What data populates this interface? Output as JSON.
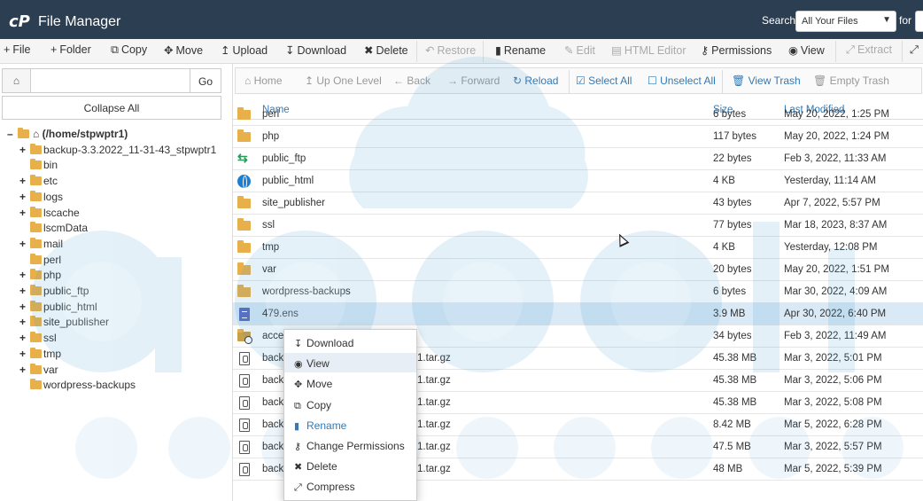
{
  "app": {
    "logo": "cP",
    "title": "File Manager"
  },
  "search": {
    "label": "Search",
    "scope": "All Your Files",
    "for_label": "for"
  },
  "toolbar": {
    "file": "File",
    "folder": "Folder",
    "copy": "Copy",
    "move": "Move",
    "upload": "Upload",
    "download": "Download",
    "delete": "Delete",
    "restore": "Restore",
    "rename": "Rename",
    "edit": "Edit",
    "html_editor": "HTML Editor",
    "permissions": "Permissions",
    "view": "View",
    "extract": "Extract"
  },
  "left": {
    "go": "Go",
    "collapse_all": "Collapse All",
    "path_value": ""
  },
  "tree": {
    "root": "(/home/stpwptr1)",
    "items": [
      {
        "label": "backup-3.3.2022_11-31-43_stpwptr1",
        "expandable": true
      },
      {
        "label": "bin",
        "expandable": false
      },
      {
        "label": "etc",
        "expandable": true
      },
      {
        "label": "logs",
        "expandable": true
      },
      {
        "label": "lscache",
        "expandable": true
      },
      {
        "label": "lscmData",
        "expandable": false
      },
      {
        "label": "mail",
        "expandable": true
      },
      {
        "label": "perl",
        "expandable": false
      },
      {
        "label": "php",
        "expandable": true
      },
      {
        "label": "public_ftp",
        "expandable": true
      },
      {
        "label": "public_html",
        "expandable": true
      },
      {
        "label": "site_publisher",
        "expandable": true
      },
      {
        "label": "ssl",
        "expandable": true
      },
      {
        "label": "tmp",
        "expandable": true
      },
      {
        "label": "var",
        "expandable": true
      },
      {
        "label": "wordpress-backups",
        "expandable": false
      }
    ]
  },
  "nav": {
    "home": "Home",
    "up": "Up One Level",
    "back": "Back",
    "forward": "Forward",
    "reload": "Reload",
    "select_all": "Select All",
    "unselect_all": "Unselect All",
    "view_trash": "View Trash",
    "empty_trash": "Empty Trash"
  },
  "columns": {
    "name": "Name",
    "size": "Size",
    "modified": "Last Modified"
  },
  "files": [
    {
      "name": "perl",
      "size": "6 bytes",
      "modified": "May 20, 2022, 1:25 PM",
      "icon": "folder-icon"
    },
    {
      "name": "php",
      "size": "117 bytes",
      "modified": "May 20, 2022, 1:24 PM",
      "icon": "folder-icon"
    },
    {
      "name": "public_ftp",
      "size": "22 bytes",
      "modified": "Feb 3, 2022, 11:33 AM",
      "icon": "transfer-icon"
    },
    {
      "name": "public_html",
      "size": "4 KB",
      "modified": "Yesterday, 11:14 AM",
      "icon": "globe-icon"
    },
    {
      "name": "site_publisher",
      "size": "43 bytes",
      "modified": "Apr 7, 2022, 5:57 PM",
      "icon": "folder-icon"
    },
    {
      "name": "ssl",
      "size": "77 bytes",
      "modified": "Mar 18, 2023, 8:37 AM",
      "icon": "folder-icon"
    },
    {
      "name": "tmp",
      "size": "4 KB",
      "modified": "Yesterday, 12:08 PM",
      "icon": "folder-icon"
    },
    {
      "name": "var",
      "size": "20 bytes",
      "modified": "May 20, 2022, 1:51 PM",
      "icon": "folder-icon"
    },
    {
      "name": "wordpress-backups",
      "size": "6 bytes",
      "modified": "Mar 30, 2022, 4:09 AM",
      "icon": "folder-icon"
    },
    {
      "name": "479.ens",
      "size": "3.9 MB",
      "modified": "Apr 30, 2022, 6:40 PM",
      "icon": "text-file-icon"
    },
    {
      "name": "acces",
      "size": "34 bytes",
      "modified": "Feb 3, 2022, 11:49 AM",
      "icon": "folder-link-icon"
    },
    {
      "name": "backu",
      "tail": "1.tar.gz",
      "size": "45.38 MB",
      "modified": "Mar 3, 2022, 5:01 PM",
      "icon": "archive-icon"
    },
    {
      "name": "backu",
      "tail": "1.tar.gz",
      "size": "45.38 MB",
      "modified": "Mar 3, 2022, 5:06 PM",
      "icon": "archive-icon"
    },
    {
      "name": "backu",
      "tail": "1.tar.gz",
      "size": "45.38 MB",
      "modified": "Mar 3, 2022, 5:08 PM",
      "icon": "archive-icon"
    },
    {
      "name": "backu",
      "tail": "1.tar.gz",
      "size": "8.42 MB",
      "modified": "Mar 5, 2022, 6:28 PM",
      "icon": "archive-icon"
    },
    {
      "name": "backu",
      "tail": "1.tar.gz",
      "size": "47.5 MB",
      "modified": "Mar 3, 2022, 5:57 PM",
      "icon": "archive-icon"
    },
    {
      "name": "backu",
      "tail": "1.tar.gz",
      "size": "48 MB",
      "modified": "Mar 5, 2022, 5:39 PM",
      "icon": "archive-icon"
    }
  ],
  "context_menu": [
    {
      "label": "Download",
      "icon": "download-icon"
    },
    {
      "label": "View",
      "icon": "eye-icon"
    },
    {
      "label": "Move",
      "icon": "move-icon"
    },
    {
      "label": "Copy",
      "icon": "copy-icon"
    },
    {
      "label": "Rename",
      "icon": "rename-icon"
    },
    {
      "label": "Change Permissions",
      "icon": "key-icon"
    },
    {
      "label": "Delete",
      "icon": "delete-icon"
    },
    {
      "label": "Compress",
      "icon": "compress-icon"
    }
  ],
  "colors": {
    "topbar": "#2b3e52",
    "link": "#337ab7",
    "selected_row": "#d9e9f5",
    "folder": "#e8b04b"
  }
}
